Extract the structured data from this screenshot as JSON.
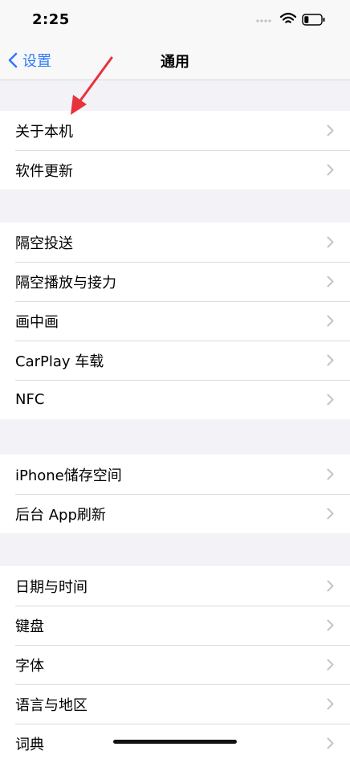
{
  "status_bar": {
    "time": "2:25"
  },
  "nav": {
    "back_label": "设置",
    "title": "通用"
  },
  "groups": [
    {
      "items": [
        {
          "label": "关于本机"
        },
        {
          "label": "软件更新"
        }
      ]
    },
    {
      "items": [
        {
          "label": "隔空投送"
        },
        {
          "label": "隔空播放与接力"
        },
        {
          "label": "画中画"
        },
        {
          "label": "CarPlay 车载"
        },
        {
          "label": "NFC"
        }
      ]
    },
    {
      "items": [
        {
          "label": "iPhone储存空间"
        },
        {
          "label": "后台 App刷新"
        }
      ]
    },
    {
      "items": [
        {
          "label": "日期与时间"
        },
        {
          "label": "键盘"
        },
        {
          "label": "字体"
        },
        {
          "label": "语言与地区"
        },
        {
          "label": "词典"
        }
      ]
    }
  ],
  "colors": {
    "accent": "#2f7cf6",
    "annotation_arrow": "#e8323c"
  }
}
